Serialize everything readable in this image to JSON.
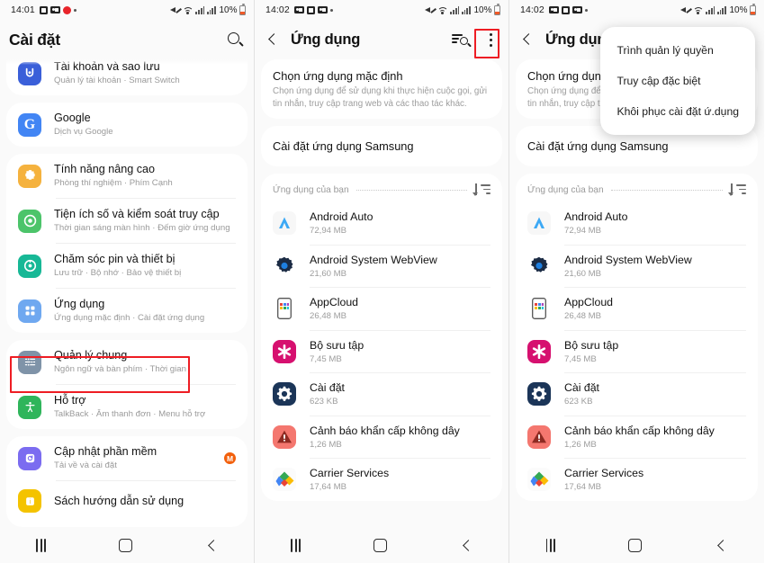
{
  "panels": [
    {
      "id": "settings",
      "status": {
        "time": "14:01",
        "battery": "10%",
        "icons": [
          "screenshot-icon",
          "camera-icon",
          "record-icon",
          "dot-icon"
        ],
        "right_icons": [
          "mute-icon",
          "wifi-icon",
          "signal-icon",
          "signal-icon",
          "battery-icon"
        ]
      },
      "appbar": {
        "title": "Cài đặt",
        "search_icon": "search-icon"
      },
      "items": [
        {
          "title": "Tài khoản và sao lưu",
          "subtitle": "Quản lý tài khoản  ·  Smart Switch",
          "icon": "accounts-icon",
          "partial": true
        },
        {
          "title": "Google",
          "subtitle": "Dịch vụ Google",
          "icon": "google-icon"
        },
        {
          "title": "Tính năng nâng cao",
          "subtitle": "Phòng thí nghiệm  ·  Phím Cạnh",
          "icon": "advanced-features-icon"
        },
        {
          "title": "Tiện ích số và kiểm soát truy cập",
          "subtitle": "Thời gian sáng màn hình  ·  Đếm giờ ứng dụng",
          "icon": "digital-wellbeing-icon"
        },
        {
          "title": "Chăm sóc pin và thiết bị",
          "subtitle": "Lưu trữ  ·  Bộ nhớ  ·  Bảo vệ thiết bị",
          "icon": "device-care-icon"
        },
        {
          "title": "Ứng dụng",
          "subtitle": "Ứng dụng mặc định  ·  Cài đặt ứng dụng",
          "icon": "apps-icon",
          "highlighted": true
        },
        {
          "title": "Quản lý chung",
          "subtitle": "Ngôn ngữ và bàn phím  ·  Thời gian",
          "icon": "general-management-icon"
        },
        {
          "title": "Hỗ trợ",
          "subtitle": "TalkBack  ·  Âm thanh đơn  ·  Menu hỗ trợ",
          "icon": "accessibility-icon"
        },
        {
          "title": "Cập nhật phần mềm",
          "subtitle": "Tải về và cài đặt",
          "icon": "software-update-icon",
          "badge": "M"
        },
        {
          "title": "Sách hướng dẫn sử dụng",
          "subtitle": "",
          "icon": "user-manual-icon",
          "partial_bottom": true
        }
      ]
    },
    {
      "id": "apps",
      "status": {
        "time": "14:02",
        "battery": "10%"
      },
      "appbar": {
        "title": "Ứng dụng",
        "back_icon": "back-arrow-icon",
        "search_icon": "search-list-icon",
        "menu_icon": "kebab-menu-icon"
      },
      "blocks": [
        {
          "title": "Chọn ứng dụng mặc định",
          "subtitle": "Chọn ứng dụng để sử dụng khi thực hiện cuộc gọi, gửi tin nhắn, truy cập trang web và các thao tác khác."
        },
        {
          "title": "Cài đặt ứng dụng Samsung",
          "subtitle": ""
        }
      ],
      "section": {
        "label": "Ứng dụng của bạn",
        "sort_icon": "sort-icon"
      },
      "apps": [
        {
          "name": "Android Auto",
          "size": "72,94 MB",
          "icon": "android-auto-icon"
        },
        {
          "name": "Android System WebView",
          "size": "21,60 MB",
          "icon": "webview-icon"
        },
        {
          "name": "AppCloud",
          "size": "26,48 MB",
          "icon": "appcloud-icon"
        },
        {
          "name": "Bộ sưu tập",
          "size": "7,45 MB",
          "icon": "collection-icon"
        },
        {
          "name": "Cài đặt",
          "size": "623 KB",
          "icon": "settings-app-icon"
        },
        {
          "name": "Cảnh báo khẩn cấp không dây",
          "size": "1,26 MB",
          "icon": "emergency-alert-icon"
        },
        {
          "name": "Carrier Services",
          "size": "17,64 MB",
          "icon": "carrier-services-icon"
        }
      ]
    },
    {
      "id": "apps-menu-open",
      "status": {
        "time": "14:02",
        "battery": "10%"
      },
      "appbar": {
        "title": "Ứng dụng",
        "back_icon": "back-arrow-icon"
      },
      "menu": {
        "items": [
          {
            "label": "Trình quản lý quyền"
          },
          {
            "label": "Truy cập đặc biệt",
            "highlighted": true
          },
          {
            "label": "Khôi phục cài đặt ứ.dụng"
          }
        ]
      },
      "blocks": [
        {
          "title": "Chọn ứng dụng mặc định",
          "subtitle": "Chọn ứng dụng để sử dụng khi thực hiện cuộc gọi, gửi tin nhắn, truy cập trang web và các thao tác khác."
        },
        {
          "title": "Cài đặt ứng dụng Samsung",
          "subtitle": ""
        }
      ],
      "section": {
        "label": "Ứng dụng của bạn",
        "sort_icon": "sort-icon"
      },
      "apps": [
        {
          "name": "Android Auto",
          "size": "72,94 MB",
          "icon": "android-auto-icon"
        },
        {
          "name": "Android System WebView",
          "size": "21,60 MB",
          "icon": "webview-icon"
        },
        {
          "name": "AppCloud",
          "size": "26,48 MB",
          "icon": "appcloud-icon"
        },
        {
          "name": "Bộ sưu tập",
          "size": "7,45 MB",
          "icon": "collection-icon"
        },
        {
          "name": "Cài đặt",
          "size": "623 KB",
          "icon": "settings-app-icon"
        },
        {
          "name": "Cảnh báo khẩn cấp không dây",
          "size": "1,26 MB",
          "icon": "emergency-alert-icon"
        },
        {
          "name": "Carrier Services",
          "size": "17,64 MB",
          "icon": "carrier-services-icon"
        }
      ]
    }
  ],
  "navbar": {
    "recent_icon": "recents-icon",
    "home_icon": "home-icon",
    "back_icon": "back-icon"
  },
  "colors": {
    "highlight": "#ee1d24",
    "google_blue": "#4285f4",
    "amber": "#f5b23e",
    "green": "#4cc46a",
    "teal": "#17b896",
    "apps_blue": "#6fa8f0",
    "slate": "#7f93a8",
    "accessibility_green": "#2fb55b",
    "purple": "#7b6cf0",
    "yellow": "#f4c300",
    "badge_orange": "#f2600c"
  }
}
